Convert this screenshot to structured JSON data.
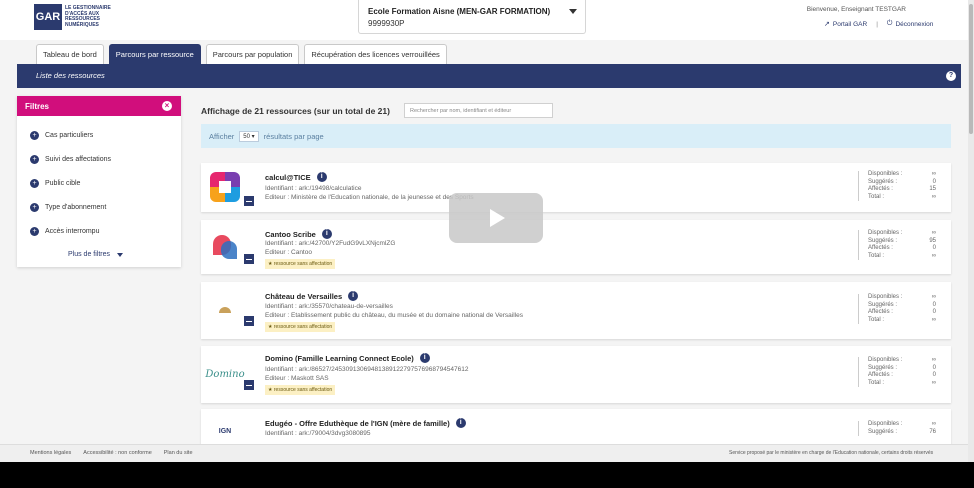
{
  "header": {
    "logo_abbr": "GAR",
    "logo_text": "LE GESTIONNAIRE D'ACCÈS AUX RESSOURCES NUMÉRIQUES",
    "school_name": "Ecole Formation Aisne (MEN-GAR FORMATION)",
    "school_code": "9999930P",
    "welcome": "Bienvenue, Enseignant TESTGAR",
    "portal_link": "Portail GAR",
    "logout_link": "Déconnexion"
  },
  "tabs": [
    {
      "label": "Tableau de bord",
      "active": false
    },
    {
      "label": "Parcours par ressource",
      "active": true
    },
    {
      "label": "Parcours par population",
      "active": false
    },
    {
      "label": "Récupération des licences verrouillées",
      "active": false
    }
  ],
  "breadcrumb": "Liste des ressources",
  "help_icon": "?",
  "filters": {
    "title": "Filtres",
    "items": [
      "Cas particuliers",
      "Suivi des affectations",
      "Public cible",
      "Type d'abonnement",
      "Accès interrompu"
    ],
    "more": "Plus de filtres"
  },
  "results": {
    "summary": "Affichage de 21 ressources (sur un total de 21)",
    "search_placeholder": "Rechercher par nom, identifiant et éditeur",
    "per_page_prefix": "Afficher",
    "per_page_value": "50",
    "per_page_suffix": "résultats par page"
  },
  "stat_labels": {
    "available": "Disponibles :",
    "suggested": "Suggérés :",
    "assigned": "Affectés :",
    "total": "Total :"
  },
  "resources": [
    {
      "title": "calcul@TICE",
      "identifier": "Identifiant : ark:/19498/calculatice",
      "publisher": "Editeur : Ministère de l'Education nationale, de la jeunesse et des Sports",
      "badge": "",
      "available": "∞",
      "suggested": "0",
      "assigned": "15",
      "total": "∞"
    },
    {
      "title": "Cantoo Scribe",
      "identifier": "Identifiant : ark:/42700/Y2FudG9vLXNjcmlZG",
      "publisher": "Editeur : Cantoo",
      "badge": "ressource sans affectation",
      "available": "∞",
      "suggested": "95",
      "assigned": "0",
      "total": "∞"
    },
    {
      "title": "Château de Versailles",
      "identifier": "Identifiant : ark:/35570/chateau-de-versailles",
      "publisher": "Editeur : Etablissement public du château, du musée et du domaine national de Versailles",
      "badge": "ressource sans affectation",
      "available": "∞",
      "suggested": "0",
      "assigned": "0",
      "total": "∞"
    },
    {
      "title": "Domino (Famille Learning Connect Ecole)",
      "identifier": "Identifiant : ark:/86527/24530913069481389122797576968794547612",
      "publisher": "Editeur : Maskott SAS",
      "badge": "ressource sans affectation",
      "available": "∞",
      "suggested": "0",
      "assigned": "0",
      "total": "∞"
    },
    {
      "title": "Edugéo - Offre Eduthèque de l'IGN (mère de famille)",
      "identifier": "Identifiant : ark:/79004/3dvg3080895",
      "publisher": "",
      "badge": "",
      "available": "∞",
      "suggested": "76",
      "assigned": "",
      "total": ""
    }
  ],
  "logos": {
    "domino": "Domino",
    "ign": "IGN"
  },
  "footer": {
    "legal": "Mentions légales",
    "accessibility": "Accessibilité : non conforme",
    "sitemap": "Plan du site",
    "right": "Service proposé par le ministère en charge de l'Education nationale, certains droits réservés"
  }
}
